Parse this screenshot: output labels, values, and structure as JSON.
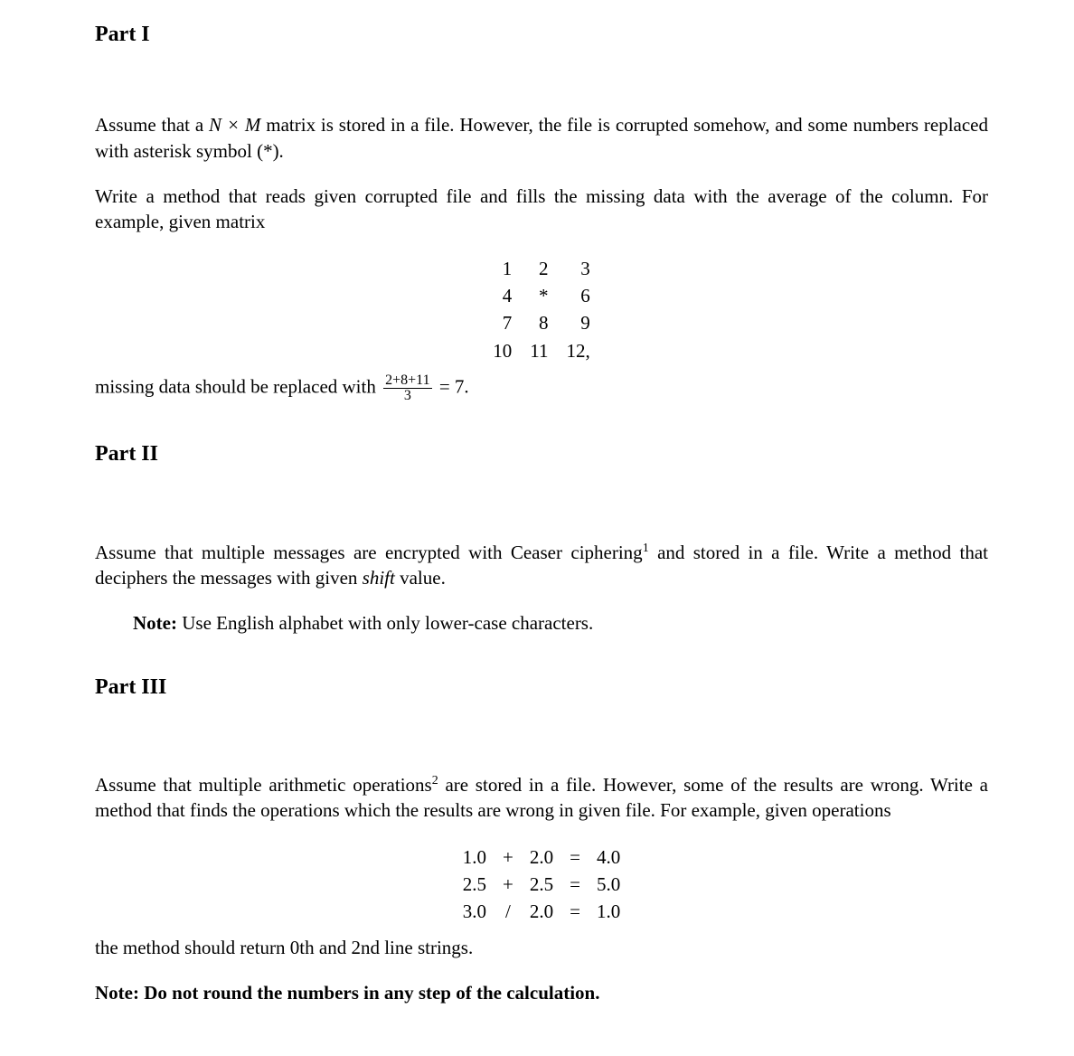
{
  "part1": {
    "heading": "Part I",
    "p1_a": "Assume that a ",
    "p1_nm": "N × M",
    "p1_b": " matrix is stored in a file. However, the file is corrupted somehow, and some numbers replaced with asterisk symbol (*).",
    "p2": "Write a method that reads given corrupted file and fills the missing data with the average of the column. For example, given matrix",
    "matrix": {
      "r1c1": "1",
      "r1c2": "2",
      "r1c3": "3",
      "r2c1": "4",
      "r2c2": "*",
      "r2c3": "6",
      "r3c1": "7",
      "r3c2": "8",
      "r3c3": "9",
      "r4c1": "10",
      "r4c2": "11",
      "r4c3": "12,"
    },
    "p3_a": "missing data should be replaced with ",
    "frac_num": "2+8+11",
    "frac_den": "3",
    "p3_b": " = 7."
  },
  "part2": {
    "heading": "Part II",
    "p1_a": "Assume that multiple messages are encrypted with Ceaser ciphering",
    "fn1": "1",
    "p1_b": " and stored in a file. Write a method that deciphers the messages with given ",
    "p1_shift": "shift",
    "p1_c": " value.",
    "note_label": "Note:",
    "note_text": " Use English alphabet with only lower-case characters."
  },
  "part3": {
    "heading": "Part III",
    "p1_a": "Assume that multiple arithmetic operations",
    "fn2": "2",
    "p1_b": " are stored in a file. However, some of the results are wrong. Write a method that finds the operations which the results are wrong in given file. For example, given operations",
    "ops": {
      "l1a": "1.0",
      "l1op": "+",
      "l1b": "2.0",
      "l1eq": "=",
      "l1r": "4.0",
      "l2a": "2.5",
      "l2op": "+",
      "l2b": "2.5",
      "l2eq": "=",
      "l2r": "5.0",
      "l3a": "3.0",
      "l3op": "/",
      "l3b": "2.0",
      "l3eq": "=",
      "l3r": "1.0"
    },
    "p2": "the method should return 0th and 2nd line strings.",
    "note": "Note: Do not round the numbers in any step of the calculation."
  }
}
